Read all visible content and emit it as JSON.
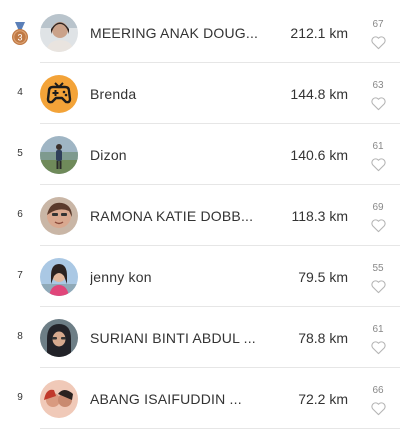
{
  "leaderboard": {
    "rows": [
      {
        "rank": "3",
        "name": "MEERING ANAK DOUG...",
        "distance": "212.1 km",
        "likes": "67",
        "avatar_icon": "user-photo-avatar",
        "medal_icon": "bronze-medal-icon"
      },
      {
        "rank": "4",
        "name": "Brenda",
        "distance": "144.8 km",
        "likes": "63",
        "avatar_icon": "gamepad-avatar"
      },
      {
        "rank": "5",
        "name": "Dizon",
        "distance": "140.6 km",
        "likes": "61",
        "avatar_icon": "user-photo-avatar"
      },
      {
        "rank": "6",
        "name": "RAMONA KATIE DOBB...",
        "distance": "118.3 km",
        "likes": "69",
        "avatar_icon": "user-photo-avatar"
      },
      {
        "rank": "7",
        "name": "jenny kon",
        "distance": "79.5 km",
        "likes": "55",
        "avatar_icon": "user-photo-avatar"
      },
      {
        "rank": "8",
        "name": "SURIANI BINTI ABDUL ...",
        "distance": "78.8 km",
        "likes": "61",
        "avatar_icon": "user-photo-avatar"
      },
      {
        "rank": "9",
        "name": "ABANG ISAIFUDDIN ...",
        "distance": "72.2 km",
        "likes": "66",
        "avatar_icon": "user-photo-avatar"
      }
    ]
  },
  "colors": {
    "medal_bronze": "#c07a45",
    "medal_ribbon": "#5a7fb8",
    "gamepad_bg": "#f3a338",
    "text": "#333333",
    "muted": "#888888",
    "heart_outline": "#b5b5b5"
  }
}
